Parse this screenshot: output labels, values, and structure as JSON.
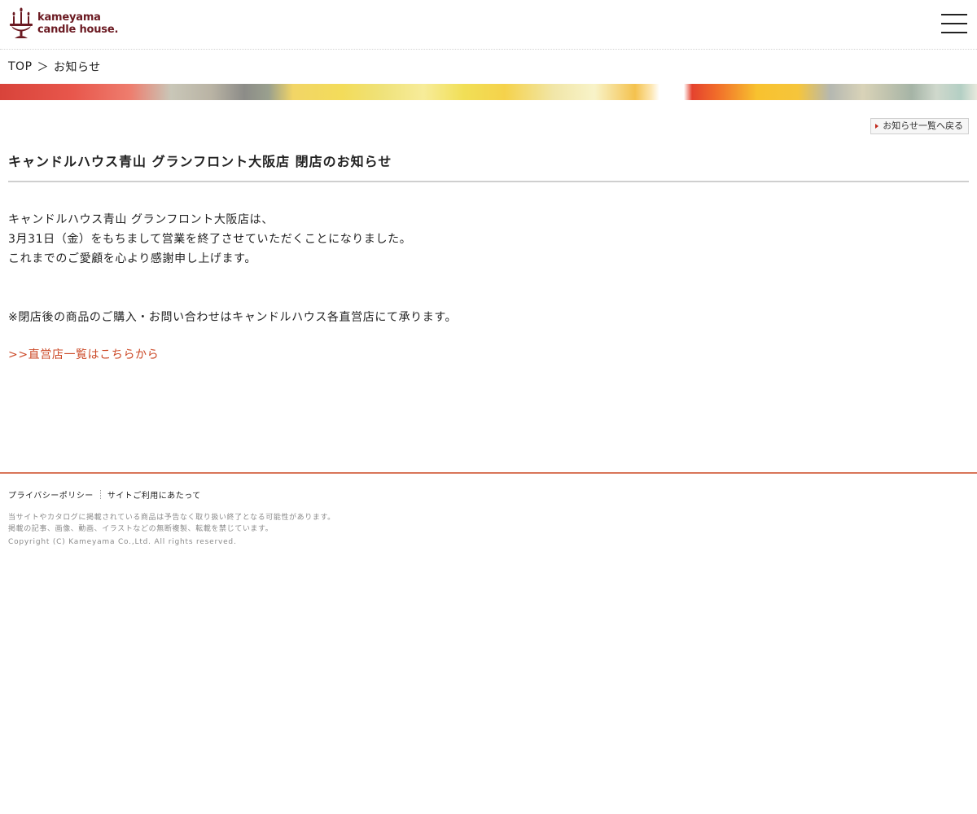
{
  "header": {
    "logo_line1": "kameyama",
    "logo_line2": "candle house",
    "logo_dot": "."
  },
  "breadcrumb": {
    "top": "TOP",
    "separator": "＞",
    "current": "お知らせ"
  },
  "back_button": "お知らせ一覧へ戻る",
  "article": {
    "title": "キャンドルハウス青山 グランフロント大阪店 閉店のお知らせ",
    "paragraphs": [
      "キャンドルハウス青山 グランフロント大阪店は、",
      "3月31日（金）をもちまして営業を終了させていただくことになりました。",
      "これまでのご愛顧を心より感謝申し上げます。"
    ],
    "note": "※閉店後の商品のご購入・お問い合わせはキャンドルハウス各直営店にて承ります。",
    "link": ">>直営店一覧はこちらから"
  },
  "footer": {
    "links": [
      "プライバシーポリシー",
      "サイトご利用にあたって"
    ],
    "notes": [
      "当サイトやカタログに掲載されている商品は予告なく取り扱い終了となる可能性があります。",
      "掲載の記事、画像、動画、イラストなどの無断複製、転載を禁じています。"
    ],
    "copyright": "Copyright (C) Kameyama Co.,Ltd. All rights reserved."
  },
  "colors": {
    "brand": "#6b1a22",
    "link": "#cc4a28",
    "footer_rule": "#d97559"
  }
}
